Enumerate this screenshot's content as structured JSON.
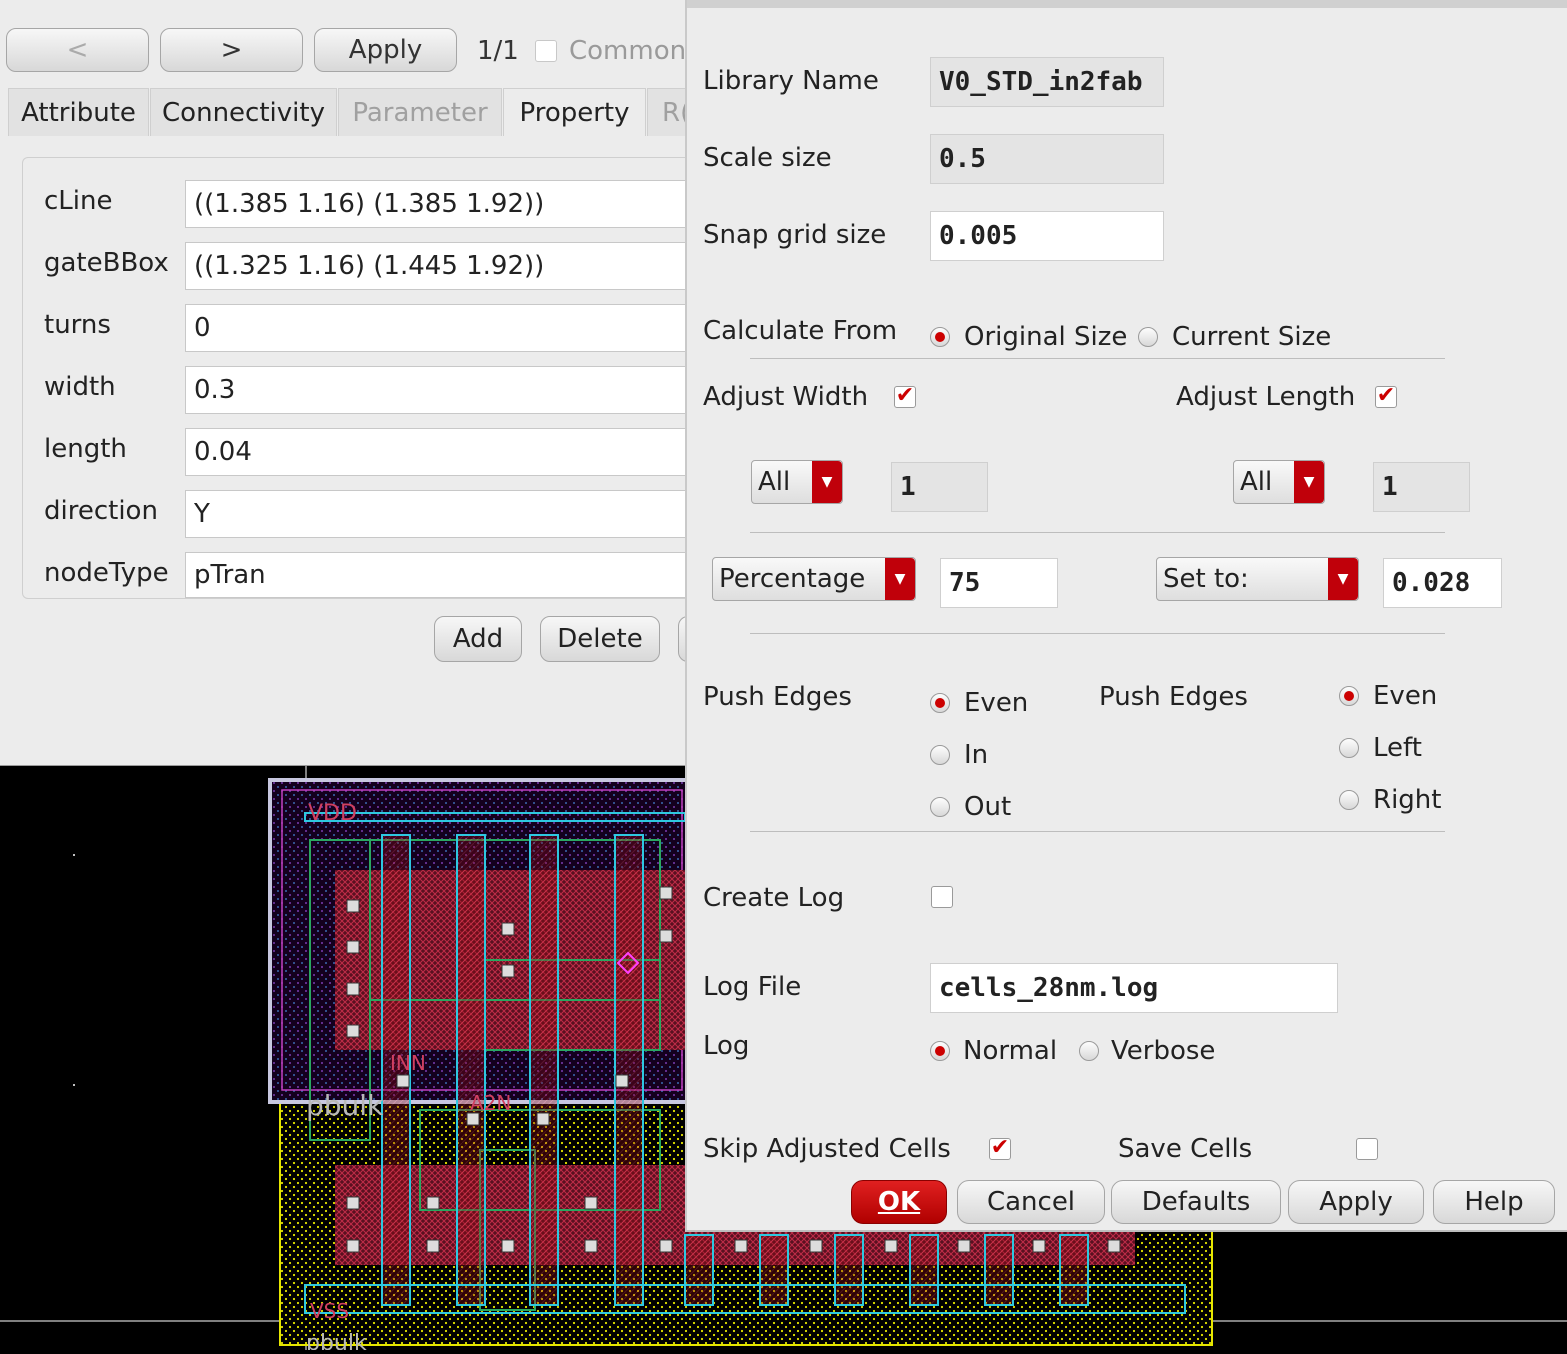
{
  "properties_window": {
    "prev_label": "<",
    "next_label": ">",
    "apply_label": "Apply",
    "page_count": "1/1",
    "common_label": "Common",
    "tabs": [
      {
        "label": "Attribute"
      },
      {
        "label": "Connectivity"
      },
      {
        "label": "Parameter"
      },
      {
        "label": "Property"
      },
      {
        "label": "R("
      }
    ],
    "rows": [
      {
        "label": "cLine",
        "value": "((1.385 1.16) (1.385 1.92))"
      },
      {
        "label": "gateBBox",
        "value": "((1.325 1.16) (1.445 1.92))"
      },
      {
        "label": "turns",
        "value": "0"
      },
      {
        "label": "width",
        "value": "0.3"
      },
      {
        "label": "length",
        "value": "0.04"
      },
      {
        "label": "direction",
        "value": "Y"
      },
      {
        "label": "nodeType",
        "value": "pTran"
      }
    ],
    "add_label": "Add",
    "delete_label": "Delete"
  },
  "layout": {
    "net_labels": [
      "VDD",
      "pbulk",
      "A2N",
      "INN",
      "VSS",
      "pbulk"
    ]
  },
  "dialog": {
    "library_name_label": "Library Name",
    "library_name_value": "V0_STD_in2fab",
    "scale_size_label": "Scale size",
    "scale_size_value": "0.5",
    "snap_grid_label": "Snap grid size",
    "snap_grid_value": "0.005",
    "calculate_from_label": "Calculate From",
    "original_size_label": "Original Size",
    "current_size_label": "Current Size",
    "adjust_width_label": "Adjust Width",
    "adjust_length_label": "Adjust Length",
    "width_scope_value": "All",
    "width_scope_number": "1",
    "length_scope_value": "All",
    "length_scope_number": "1",
    "width_mode_value": "Percentage",
    "width_mode_number": "75",
    "length_mode_value": "Set to:",
    "length_mode_number": "0.028",
    "push_edges_width_label": "Push Edges",
    "push_edges_width_options": [
      "Even",
      "In",
      "Out"
    ],
    "push_edges_length_label": "Push Edges",
    "push_edges_length_options": [
      "Even",
      "Left",
      "Right"
    ],
    "create_log_label": "Create Log",
    "log_file_label": "Log File",
    "log_file_value": "cells_28nm.log",
    "log_label": "Log",
    "log_normal_label": "Normal",
    "log_verbose_label": "Verbose",
    "skip_adjusted_label": "Skip Adjusted Cells",
    "save_cells_label": "Save Cells",
    "buttons": {
      "ok": "OK",
      "cancel": "Cancel",
      "defaults": "Defaults",
      "apply": "Apply",
      "help": "Help"
    }
  },
  "colors": {
    "accent": "#cc0000",
    "metal_red": "#b0101a",
    "poly_cyan": "#2ec8e0",
    "nwell_yellow": "#e6e600",
    "boundary_purple": "#8a2be2"
  }
}
